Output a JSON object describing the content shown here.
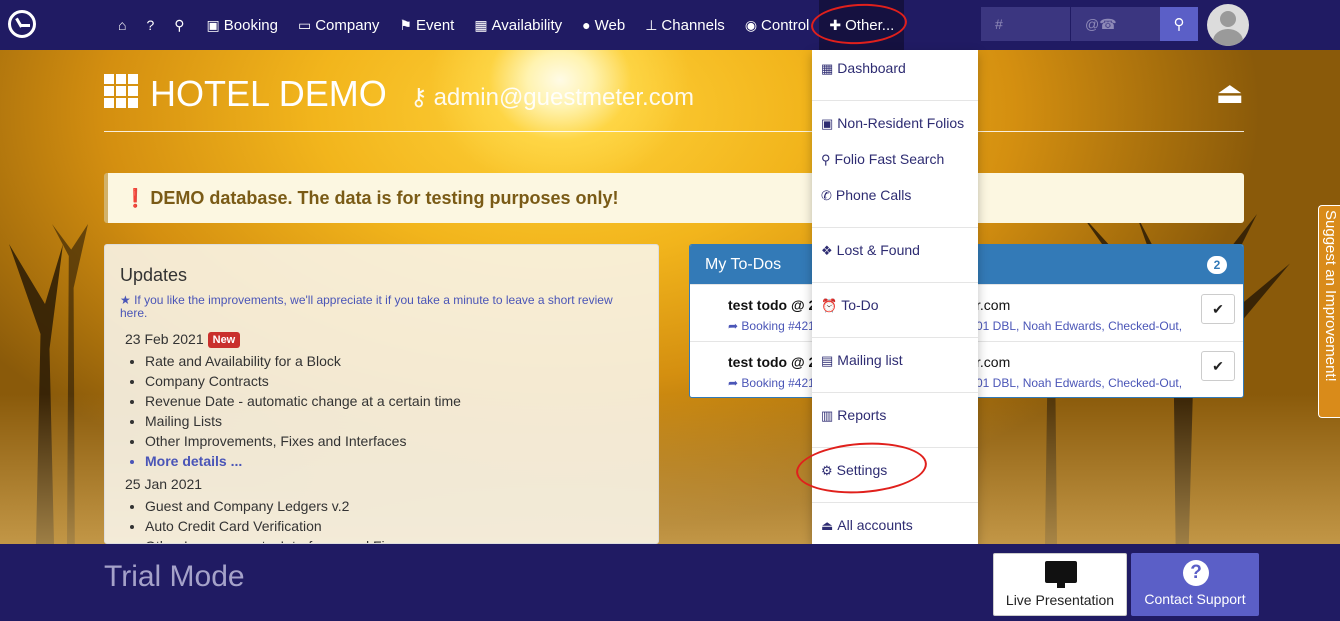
{
  "navbar": {
    "items": [
      {
        "icon": "home-icon",
        "glyph": "⌂",
        "label": ""
      },
      {
        "icon": "help-icon",
        "glyph": "?",
        "label": ""
      },
      {
        "icon": "zoom-icon",
        "glyph": "⚲",
        "label": ""
      },
      {
        "icon": "briefcase-icon",
        "glyph": "▣",
        "label": "Booking"
      },
      {
        "icon": "folder-icon",
        "glyph": "▭",
        "label": "Company"
      },
      {
        "icon": "flag-icon",
        "glyph": "⚑",
        "label": "Event"
      },
      {
        "icon": "calendar-icon",
        "glyph": "▦",
        "label": "Availability"
      },
      {
        "icon": "globe-icon",
        "glyph": "●",
        "label": "Web"
      },
      {
        "icon": "sitemap-icon",
        "glyph": "⊥",
        "label": "Channels"
      },
      {
        "icon": "eye-icon",
        "glyph": "◉",
        "label": "Control"
      },
      {
        "icon": "puzzle-icon",
        "glyph": "✚",
        "label": "Other..."
      }
    ],
    "search": {
      "number_placeholder": "#",
      "contact_placeholder": "@☎"
    }
  },
  "header": {
    "hotel_title": "HOTEL DEMO",
    "admin_email": "admin@guestmeter.com"
  },
  "alert": {
    "text": "DEMO database. The data is for testing purposes only!"
  },
  "updates": {
    "title": "Updates",
    "review_text": "If you like the improvements, we'll appreciate it if you take a minute to leave a short review here.",
    "releases": [
      {
        "date": "23 Feb 2021",
        "badge": "New",
        "items": [
          "Rate and Availability for a Block",
          "Company Contracts",
          "Revenue Date - automatic change at a certain time",
          "Mailing Lists",
          "Other Improvements, Fixes and Interfaces"
        ],
        "more": "More details ..."
      },
      {
        "date": "25 Jan 2021",
        "items": [
          "Guest and Company Ledgers v.2",
          "Auto Credit Card Verification",
          "Other Improvements, Interfaces and Fixes"
        ]
      }
    ]
  },
  "todos": {
    "title": "My To-Dos",
    "count": "2",
    "rows": [
      {
        "title": "test todo @ 2",
        "title_right": "r.com",
        "sub": "Booking #421",
        "sub_right": "01 DBL, Noah Edwards, Checked-Out,"
      },
      {
        "title": "test todo @ 2",
        "title_right": "r.com",
        "sub": "Booking #421",
        "sub_right": "01 DBL, Noah Edwards, Checked-Out,"
      }
    ]
  },
  "dropdown": {
    "items": [
      {
        "label": "Dashboard",
        "icon": "grid-icon",
        "glyph": "▦"
      },
      {
        "label": "Non-Resident Folios",
        "icon": "money-icon",
        "glyph": "▣"
      },
      {
        "label": "Folio Fast Search",
        "icon": "search-icon",
        "glyph": "⚲"
      },
      {
        "label": "Phone Calls",
        "icon": "phone-icon",
        "glyph": "✆"
      },
      {
        "label": "Lost & Found",
        "icon": "dropbox-icon",
        "glyph": "❖"
      },
      {
        "label": "To-Do",
        "icon": "alarm-icon",
        "glyph": "⏰"
      },
      {
        "label": "Mailing list",
        "icon": "list-icon",
        "glyph": "▤"
      },
      {
        "label": "Reports",
        "icon": "chart-icon",
        "glyph": "▥"
      },
      {
        "label": "Settings",
        "icon": "cogs-icon",
        "glyph": "⚙"
      },
      {
        "label": "All accounts",
        "icon": "eject-icon",
        "glyph": "⏏"
      }
    ]
  },
  "suggest": {
    "label": "Suggest an Improvement!"
  },
  "footer": {
    "trial": "Trial Mode",
    "live_label": "Live Presentation",
    "support_label": "Contact Support"
  },
  "colors": {
    "navbar": "#201b63",
    "accent": "#5b5fc7",
    "panel_header": "#337ab7",
    "annotation": "#e0201c"
  }
}
